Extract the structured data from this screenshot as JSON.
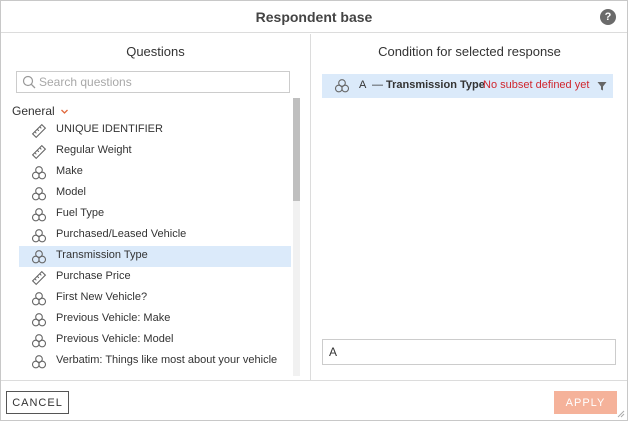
{
  "dialog": {
    "title": "Respondent base",
    "help_icon": "help-icon",
    "help_glyph": "?"
  },
  "questions_panel": {
    "heading": "Questions",
    "search_placeholder": "Search questions",
    "search_value": "",
    "group_label": "General",
    "items": [
      {
        "label": "UNIQUE IDENTIFIER",
        "icon": "ruler-icon",
        "selected": false
      },
      {
        "label": "Regular Weight",
        "icon": "ruler-icon",
        "selected": false
      },
      {
        "label": "Make",
        "icon": "category-icon",
        "selected": false
      },
      {
        "label": "Model",
        "icon": "category-icon",
        "selected": false
      },
      {
        "label": "Fuel Type",
        "icon": "category-icon",
        "selected": false
      },
      {
        "label": "Purchased/Leased Vehicle",
        "icon": "category-icon",
        "selected": false
      },
      {
        "label": "Transmission Type",
        "icon": "category-icon",
        "selected": true
      },
      {
        "label": "Purchase Price",
        "icon": "ruler-icon",
        "selected": false
      },
      {
        "label": "First New Vehicle?",
        "icon": "category-icon",
        "selected": false
      },
      {
        "label": "Previous Vehicle: Make",
        "icon": "category-icon",
        "selected": false
      },
      {
        "label": "Previous Vehicle: Model",
        "icon": "category-icon",
        "selected": false
      },
      {
        "label": "Verbatim: Things like most about your vehicle",
        "icon": "category-icon",
        "selected": false
      }
    ]
  },
  "condition_panel": {
    "heading": "Condition for selected response",
    "row": {
      "letter": "A",
      "dash": "—",
      "question": "Transmission Type",
      "status": "No subset defined yet"
    },
    "expression": "A"
  },
  "footer": {
    "cancel_label": "CANCEL",
    "apply_label": "APPLY"
  },
  "colors": {
    "selected_row": "#dbeafa",
    "status_red": "#d0262e",
    "apply_bg": "#f5b29a",
    "accent_chevron": "#e0683c"
  }
}
